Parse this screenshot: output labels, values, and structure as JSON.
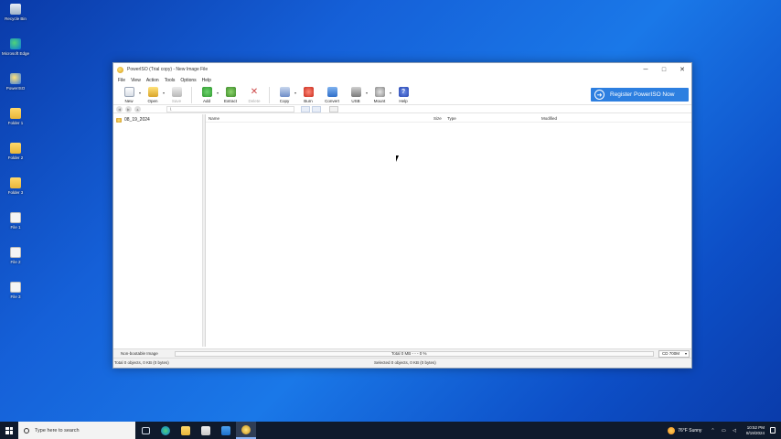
{
  "desktop": {
    "icons": [
      {
        "label": "Recycle Bin",
        "icon": "recycle-bin-icon"
      },
      {
        "label": "Microsoft Edge",
        "icon": "edge-icon"
      },
      {
        "label": "PowerISO",
        "icon": "poweriso-icon"
      },
      {
        "label": "Folder 1",
        "icon": "folder-icon"
      },
      {
        "label": "Folder 2",
        "icon": "folder-icon"
      },
      {
        "label": "Folder 3",
        "icon": "folder-icon"
      },
      {
        "label": "File 1",
        "icon": "file-icon"
      },
      {
        "label": "File 2",
        "icon": "file-icon"
      },
      {
        "label": "File 3",
        "icon": "file-icon"
      }
    ]
  },
  "window": {
    "title": "PowerISO (Trial copy) - New Image File",
    "controls": {
      "minimize": "─",
      "maximize": "□",
      "close": "✕"
    }
  },
  "menu": [
    "File",
    "View",
    "Action",
    "Tools",
    "Options",
    "Help"
  ],
  "toolbar": {
    "new": "New",
    "open": "Open",
    "save": "Save",
    "add": "Add",
    "extract": "Extract",
    "delete": "Delete",
    "copy": "Copy",
    "burn": "Burn",
    "convert": "Convert",
    "usb": "USB",
    "mount": "Mount",
    "help": "Help",
    "register": "Register PowerISO Now"
  },
  "navbar": {
    "path": "\\"
  },
  "tree": {
    "root": "08_19_2024"
  },
  "list": {
    "columns": [
      "Name",
      "Size",
      "Type",
      "Modified"
    ]
  },
  "status": {
    "image_type": "Non-bootable Image",
    "total": "Total 0 MB  - - -  0 %",
    "media": "CD 700M",
    "objects_total": "Total 0 objects, 0 KB (0 bytes)",
    "objects_selected": "Selected 0 objects, 0 KB (0 bytes)",
    "progress_percent": 0
  },
  "taskbar": {
    "search_placeholder": "Type here to search",
    "weather": "76°F  Sunny",
    "time": "10:52 PM",
    "date": "8/19/2024"
  }
}
